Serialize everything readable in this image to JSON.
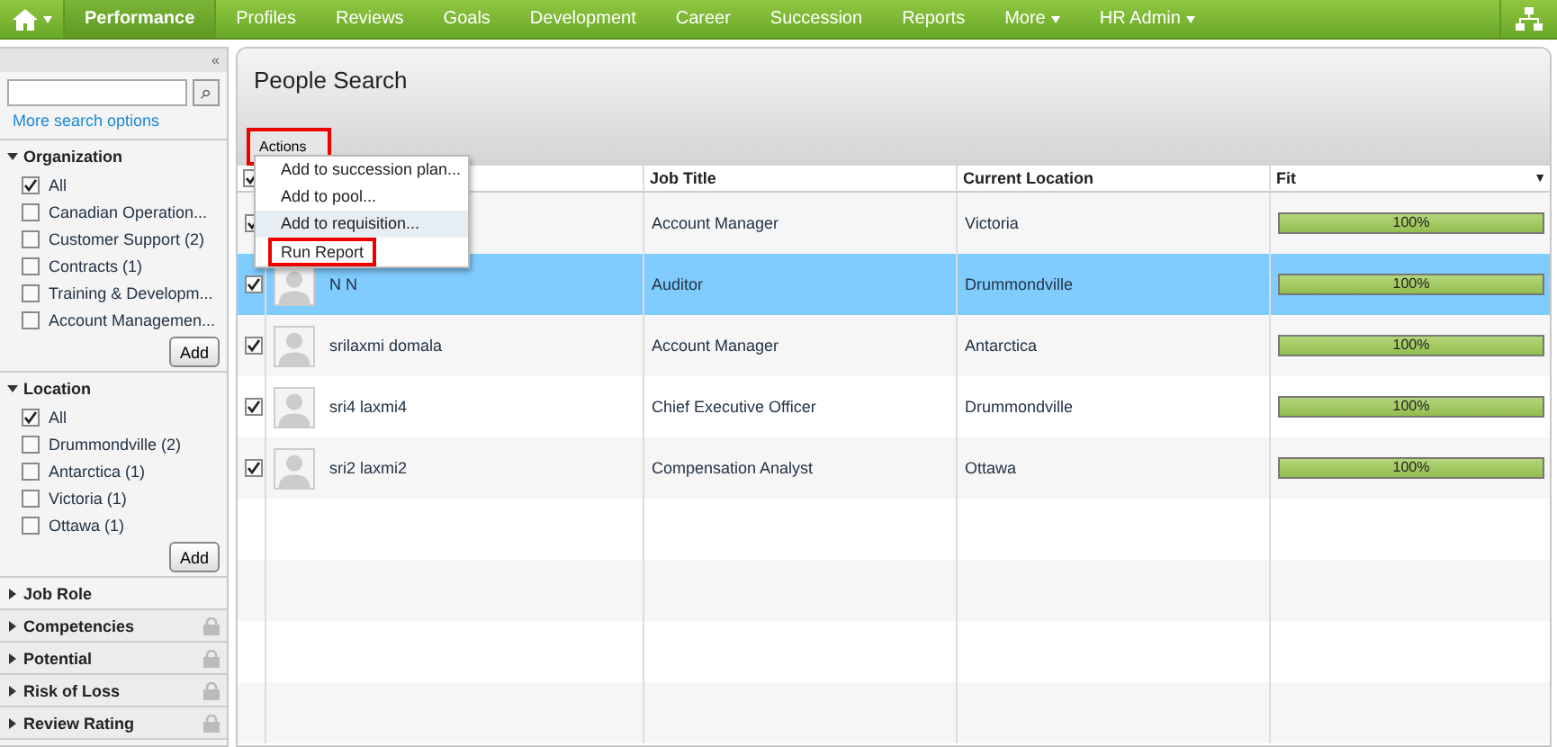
{
  "nav": {
    "items": [
      {
        "label": "Performance",
        "selected": true,
        "dropdown": false
      },
      {
        "label": "Profiles",
        "selected": false,
        "dropdown": false
      },
      {
        "label": "Reviews",
        "selected": false,
        "dropdown": false
      },
      {
        "label": "Goals",
        "selected": false,
        "dropdown": false
      },
      {
        "label": "Development",
        "selected": false,
        "dropdown": false
      },
      {
        "label": "Career",
        "selected": false,
        "dropdown": false
      },
      {
        "label": "Succession",
        "selected": false,
        "dropdown": false
      },
      {
        "label": "Reports",
        "selected": false,
        "dropdown": false
      },
      {
        "label": "More",
        "selected": false,
        "dropdown": true
      },
      {
        "label": "HR Admin",
        "selected": false,
        "dropdown": true
      }
    ]
  },
  "sidebar": {
    "collapse": "«",
    "search_button": "⌕",
    "more_link": "More search options",
    "filters": [
      {
        "title": "Organization",
        "expanded": true,
        "locked": false,
        "add": "Add",
        "options": [
          {
            "label": "All",
            "checked": true
          },
          {
            "label": "Canadian Operation...",
            "checked": false
          },
          {
            "label": "Customer Support (2)",
            "checked": false
          },
          {
            "label": "Contracts (1)",
            "checked": false
          },
          {
            "label": "Training & Developm...",
            "checked": false
          },
          {
            "label": "Account Managemen...",
            "checked": false
          }
        ]
      },
      {
        "title": "Location",
        "expanded": true,
        "locked": false,
        "add": "Add",
        "options": [
          {
            "label": "All",
            "checked": true
          },
          {
            "label": "Drummondville (2)",
            "checked": false
          },
          {
            "label": "Antarctica (1)",
            "checked": false
          },
          {
            "label": "Victoria (1)",
            "checked": false
          },
          {
            "label": "Ottawa (1)",
            "checked": false
          }
        ]
      },
      {
        "title": "Job Role",
        "expanded": false,
        "locked": false
      },
      {
        "title": "Competencies",
        "expanded": false,
        "locked": true
      },
      {
        "title": "Potential",
        "expanded": false,
        "locked": true
      },
      {
        "title": "Risk of Loss",
        "expanded": false,
        "locked": true
      },
      {
        "title": "Review Rating",
        "expanded": false,
        "locked": true
      }
    ]
  },
  "main": {
    "title": "People Search",
    "actions": {
      "label": "Actions",
      "highlighted": true
    },
    "menu": [
      {
        "label": "Add to succession plan...",
        "hovered": false,
        "highlighted": false
      },
      {
        "label": "Add to pool...",
        "hovered": false,
        "highlighted": false
      },
      {
        "label": "Add to requisition...",
        "hovered": true,
        "highlighted": false
      },
      {
        "label": "Run Report",
        "hovered": false,
        "highlighted": true
      }
    ],
    "table": {
      "header_checked": true,
      "columns": [
        "Job Title",
        "Current Location",
        "Fit"
      ],
      "sort_mark": "▼",
      "rows": [
        {
          "checked": true,
          "selected": false,
          "job_title": "Account Manager",
          "location": "Victoria",
          "fit": "100%",
          "level": 1
        },
        {
          "checked": true,
          "selected": true,
          "name": "N N",
          "job_title": "Auditor",
          "location": "Drummondville",
          "fit": "100%",
          "level": 1
        },
        {
          "checked": true,
          "selected": false,
          "name": "srilaxmi domala",
          "job_title": "Account Manager",
          "location": "Antarctica",
          "fit": "100%",
          "level": 1
        },
        {
          "checked": true,
          "selected": false,
          "name": "sri4 laxmi4",
          "job_title": "Chief Executive Officer",
          "location": "Drummondville",
          "fit": "100%",
          "level": 1
        },
        {
          "checked": true,
          "selected": false,
          "name": "sri2 laxmi2",
          "job_title": "Compensation Analyst",
          "location": "Ottawa",
          "fit": "100%",
          "level": 1
        }
      ]
    }
  }
}
